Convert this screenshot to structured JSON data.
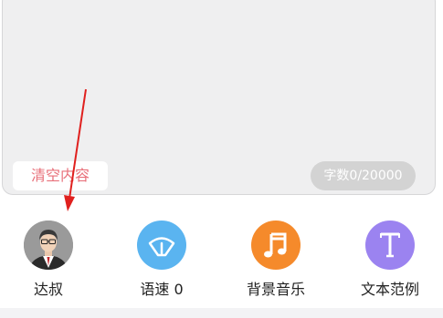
{
  "editor": {
    "clear_label": "清空内容",
    "char_count": "字数0/20000"
  },
  "toolbar": {
    "items": [
      {
        "label": "达叔",
        "icon": "voice-avatar-icon",
        "color": "#8e8e8e"
      },
      {
        "label": "语速 0",
        "icon": "speed-gauge-icon",
        "color": "#5ab4f0"
      },
      {
        "label": "背景音乐",
        "icon": "music-note-icon",
        "color": "#f58a2b"
      },
      {
        "label": "文本范例",
        "icon": "text-t-icon",
        "color": "#9b83f0"
      }
    ]
  },
  "colors": {
    "annotation_arrow": "#e0201e",
    "clear_text": "#e8707a",
    "editor_bg": "#efeff0"
  }
}
